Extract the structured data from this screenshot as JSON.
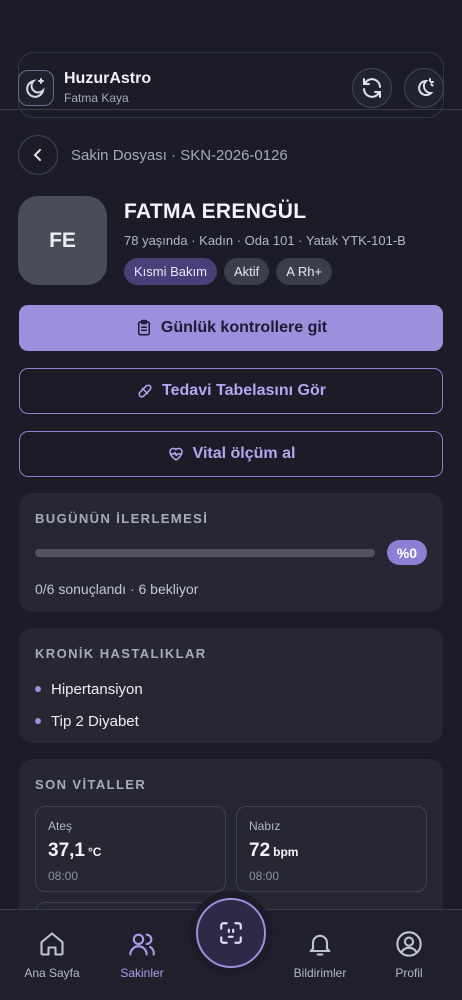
{
  "header": {
    "app_name": "HuzurAstro",
    "user_name": "Fatma Kaya",
    "app_icon": "moon-star-icon",
    "actions": [
      "refresh-icon",
      "theme-icon"
    ]
  },
  "breadcrumb": {
    "text": "Sakin Dosyası · SKN-2026-0126"
  },
  "resident": {
    "initials": "FE",
    "name": "FATMA ERENGÜL",
    "meta": "78 yaşında · Kadın · Oda 101 · Yatak YTK-101-B",
    "badges": [
      "Kısmi Bakım",
      "Aktif",
      "A Rh+"
    ]
  },
  "actions": {
    "daily_checks": "Günlük kontrollere git",
    "treatment_chart": "Tedavi Tabelasını Gör",
    "vital_measure": "Vital ölçüm al"
  },
  "progress": {
    "title": "BUGÜNÜN İLERLEMESİ",
    "fraction": 0,
    "percent_label": "%0",
    "note": "0/6 sonuçlandı · 6 bekliyor"
  },
  "chronic": {
    "title": "KRONİK HASTALIKLAR",
    "items": [
      "Hipertansiyon",
      "Tip 2 Diyabet"
    ]
  },
  "vitals": {
    "title": "SON VİTALLER",
    "items": [
      {
        "label": "Ateş",
        "value": "37,1",
        "unit": "°C",
        "time": "08:00"
      },
      {
        "label": "Nabız",
        "value": "72",
        "unit": "bpm",
        "time": "08:00"
      }
    ]
  },
  "nav": {
    "home": "Ana Sayfa",
    "residents": "Sakinler",
    "notifications": "Bildirimler",
    "profile": "Profil"
  },
  "colors": {
    "accent": "#9c8fdc",
    "background": "#1b1c27",
    "card": "#262733"
  }
}
